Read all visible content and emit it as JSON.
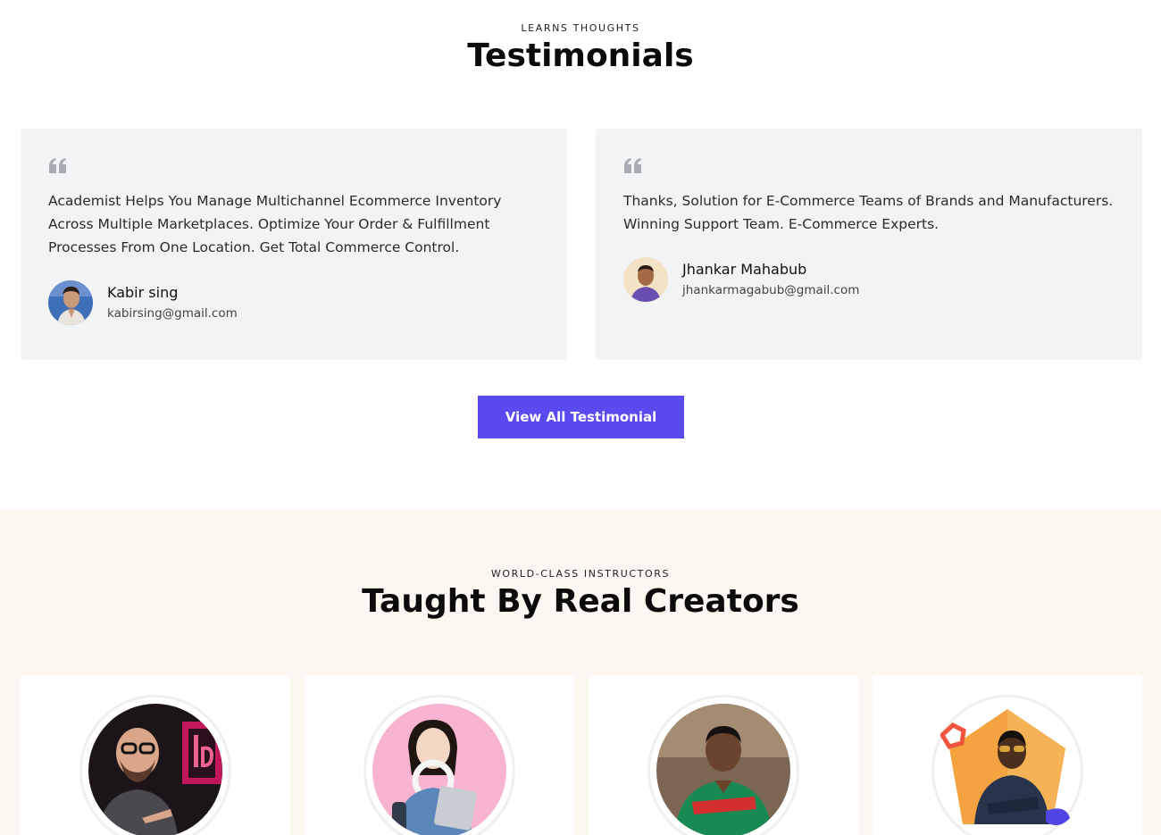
{
  "testimonials": {
    "eyebrow": "LEARNS THOUGHTS",
    "heading": "Testimonials",
    "items": [
      {
        "text": "Academist Helps You Manage Multichannel Ecommerce Inventory Across Multiple Marketplaces. Optimize Your Order & Fulfillment Processes From One Location. Get Total Commerce Control.",
        "name": "Kabir sing",
        "email": "kabirsing@gmail.com",
        "avatar_icon": "person-avatar-icon"
      },
      {
        "text": "Thanks, Solution for E-Commerce Teams of Brands and Manufacturers. Winning Support Team. E-Commerce Experts.",
        "name": "Jhankar Mahabub",
        "email": "jhankarmagabub@gmail.com",
        "avatar_icon": "person-avatar-icon"
      }
    ],
    "button_label": "View All Testimonial"
  },
  "instructors": {
    "eyebrow": "WORLD-CLASS INSTRUCTORS",
    "heading": "Taught By Real Creators"
  },
  "colors": {
    "accent": "#5a4bf0",
    "card_bg": "#f2f3f5",
    "instructor_section_bg": "#fdf7f1"
  }
}
